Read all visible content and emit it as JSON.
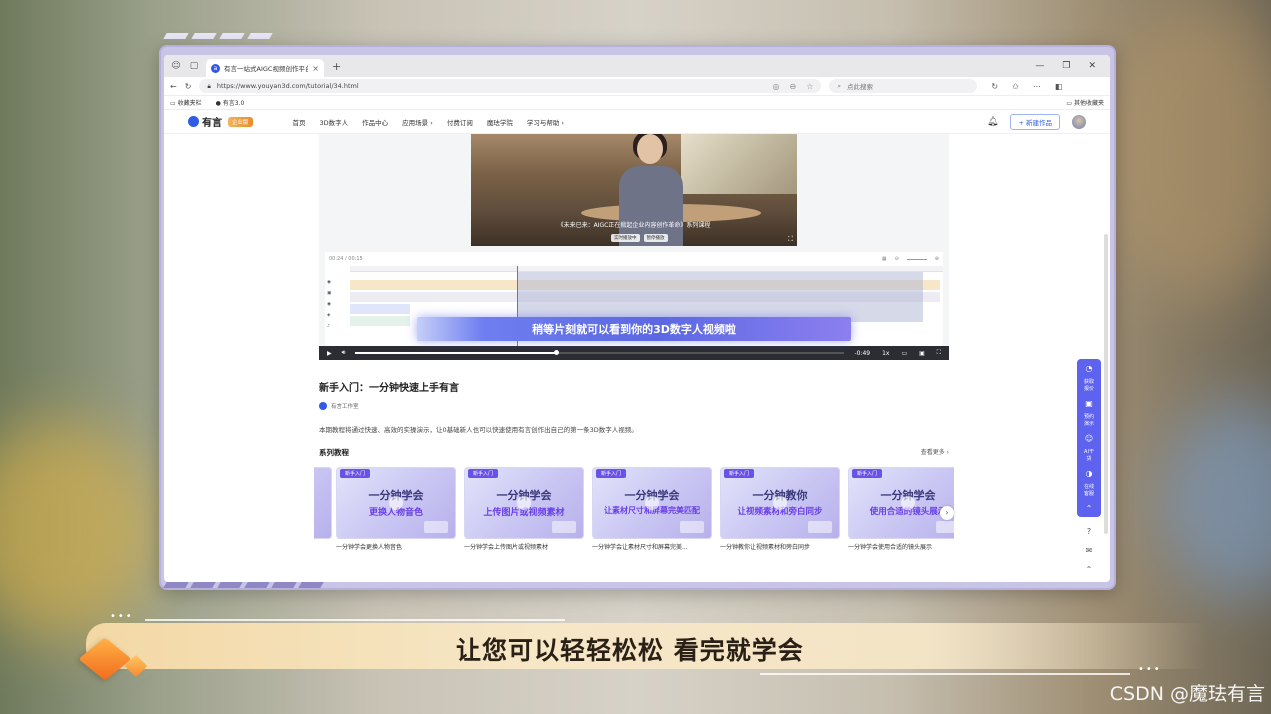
{
  "browser": {
    "tab_title": "有言一站式AIGC视频创作平台",
    "url": "https://www.youyan3d.com/tutorial/34.html",
    "search_placeholder": "点此搜索",
    "bookmarks": [
      "收藏夹栏",
      "有言3.0"
    ],
    "other_bookmarks": "其他收藏夹"
  },
  "site": {
    "logo_text": "有言",
    "enterprise_badge": "企业版",
    "nav": [
      "首页",
      "3D数字人",
      "作品中心",
      "应用场景 ›",
      "付费订阅",
      "魔珐学院",
      "学习与帮助 ›"
    ],
    "new_work_button": "+ 新建作品"
  },
  "player": {
    "video_caption": "《未来已来：AIGC正在掀起企业内容创作革命》系列课程",
    "video_pills": [
      "实时播放中",
      "暂停播放"
    ],
    "timeline_time": "00:24 / 00:15",
    "subtitle": "稍等片刻就可以看到你的3D数字人视频啦",
    "remaining_time": "-0:49",
    "speed": "1x",
    "progress": 0.41
  },
  "course": {
    "title": "新手入门：一分钟快速上手有言",
    "author": "有言工作室",
    "description": "本期教程将通过快速、高效的实操演示，让0基础新人也可以快速使用有言创作出自己的第一条3D数字人视频。"
  },
  "series": {
    "heading": "系列教程",
    "more": "查看更多 ›",
    "cards": [
      {
        "tag": "新手入门",
        "line1": "一分钟学会",
        "line2": "更换人物音色",
        "caption": "一分钟学会更换人物音色"
      },
      {
        "tag": "新手入门",
        "line1": "一分钟学会",
        "line2": "上传图片或视频素材",
        "caption": "一分钟学会上传图片或视频素材"
      },
      {
        "tag": "新手入门",
        "line1": "一分钟学会",
        "line2": "让素材尺寸和屏幕完美匹配",
        "caption": "一分钟学会让素材尺寸和屏幕完美..."
      },
      {
        "tag": "新手入门",
        "line1": "一分钟教你",
        "line2": "让视频素材和旁白同步",
        "caption": "一分钟教你让视频素材和旁白同步"
      },
      {
        "tag": "新手入门",
        "line1": "一分钟学会",
        "line2": "使用合适的镜头展示",
        "caption": "一分钟学会使用合适的镜头展示"
      }
    ]
  },
  "side_float": [
    "获取报价",
    "预约演示",
    "AI干货",
    "在线客服"
  ],
  "lower_third": "让您可以轻轻松松 看完就学会",
  "watermark": "CSDN @魔珐有言",
  "colors": {
    "brand_blue": "#2f5be6",
    "accent_purple": "#5d62ef",
    "banner_gold": "#f3d8a5"
  }
}
